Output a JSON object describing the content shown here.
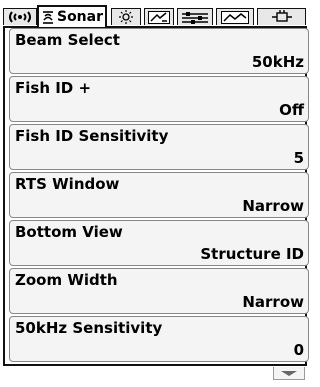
{
  "tabs": [
    {
      "icon": "sonar-waves-icon",
      "label": ""
    },
    {
      "icon": "sonar-icon",
      "label": "Sonar",
      "active": true
    },
    {
      "icon": "sun-icon",
      "label": ""
    },
    {
      "icon": "navigation-icon",
      "label": ""
    },
    {
      "icon": "setup-icon",
      "label": ""
    },
    {
      "icon": "chart-icon",
      "label": ""
    },
    {
      "icon": "accessories-icon",
      "label": ""
    }
  ],
  "menu": {
    "items": [
      {
        "title": "Beam Select",
        "value": "50kHz"
      },
      {
        "title": "Fish ID +",
        "value": "Off"
      },
      {
        "title": "Fish ID Sensitivity",
        "value": "5"
      },
      {
        "title": "RTS Window",
        "value": "Narrow"
      },
      {
        "title": "Bottom View",
        "value": "Structure ID"
      },
      {
        "title": "Zoom Width",
        "value": "Narrow"
      },
      {
        "title": "50kHz Sensitivity",
        "value": "0"
      }
    ]
  },
  "scroll": {
    "icon": "scroll-down-icon"
  }
}
